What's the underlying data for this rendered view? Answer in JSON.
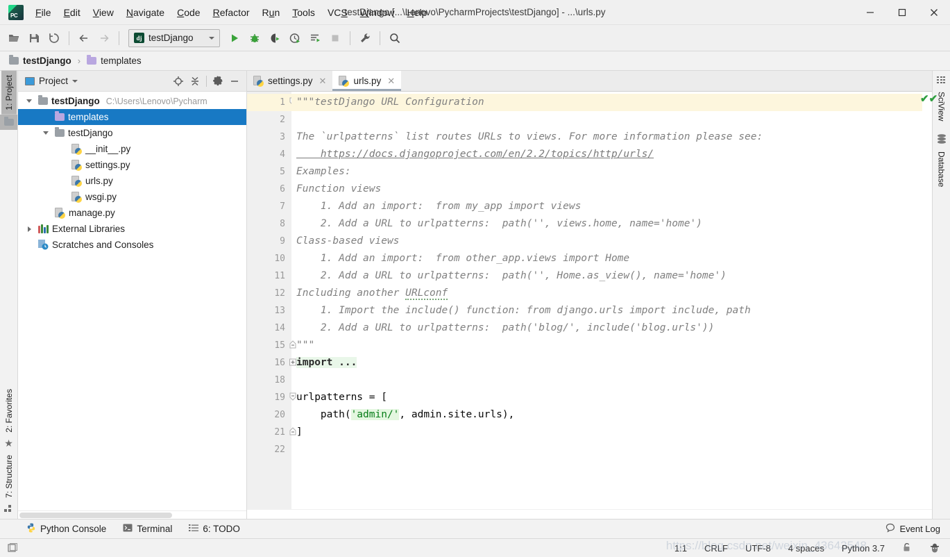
{
  "window": {
    "title": "testDjango [...\\Lenovo\\PycharmProjects\\testDjango] - ...\\urls.py",
    "logo_text": "PC",
    "minimize": "—",
    "maximize": "☐",
    "close": "✕"
  },
  "menubar": {
    "items": [
      {
        "label": "File",
        "mnemonic": "F"
      },
      {
        "label": "Edit",
        "mnemonic": "E"
      },
      {
        "label": "View",
        "mnemonic": "V"
      },
      {
        "label": "Navigate",
        "mnemonic": "N"
      },
      {
        "label": "Code",
        "mnemonic": "C"
      },
      {
        "label": "Refactor",
        "mnemonic": "R"
      },
      {
        "label": "Run",
        "mnemonic": "u"
      },
      {
        "label": "Tools",
        "mnemonic": "T"
      },
      {
        "label": "VCS",
        "mnemonic": "S"
      },
      {
        "label": "Window",
        "mnemonic": "W"
      },
      {
        "label": "Help",
        "mnemonic": "H"
      }
    ]
  },
  "toolbar": {
    "run_config": {
      "label": "testDjango",
      "icon_text": "dj"
    },
    "buttons": [
      "open-project-icon",
      "save-all-icon",
      "sync-icon",
      "navigate-back-icon",
      "navigate-forward-icon",
      "run-icon",
      "debug-icon",
      "run-coverage-icon",
      "profile-icon",
      "run-to-cursor-icon",
      "stop-icon",
      "settings-wrench-icon",
      "search-everywhere-icon"
    ]
  },
  "breadcrumb": {
    "items": [
      {
        "label": "testDjango",
        "icon": "folder-icon",
        "color": "#9aa0a6",
        "bold": true
      },
      {
        "label": "templates",
        "icon": "folder-icon",
        "color": "#b9a7e0",
        "bold": false
      }
    ],
    "separator": "›"
  },
  "left_strip": {
    "tabs": [
      {
        "label": "1: Project",
        "mnemonic": "1",
        "active": true,
        "icon": "project-folder-icon"
      },
      {
        "label": "2: Favorites",
        "mnemonic": "2",
        "active": false,
        "icon": "star-icon"
      },
      {
        "label": "7: Structure",
        "mnemonic": "7",
        "active": false,
        "icon": "structure-icon"
      }
    ]
  },
  "right_strip": {
    "tabs": [
      {
        "label": "SciView",
        "icon": "grid-icon"
      },
      {
        "label": "Database",
        "icon": "database-icon"
      }
    ]
  },
  "project_panel": {
    "title": "Project",
    "header_icons": [
      "locate-target-icon",
      "collapse-all-icon",
      "gear-icon",
      "minimize-icon"
    ],
    "tree": [
      {
        "label": "testDjango",
        "path": "C:\\Users\\Lenovo\\Pycharm",
        "depth": 0,
        "icon": "folder-icon",
        "expander": "down",
        "bold": true,
        "selected": false
      },
      {
        "label": "templates",
        "path": "",
        "depth": 1,
        "icon": "folder-purple-icon",
        "expander": "none",
        "bold": false,
        "selected": true
      },
      {
        "label": "testDjango",
        "path": "",
        "depth": 1,
        "icon": "package-folder-icon",
        "expander": "down",
        "bold": false,
        "selected": false
      },
      {
        "label": "__init__.py",
        "path": "",
        "depth": 2,
        "icon": "python-file-icon",
        "expander": "none",
        "bold": false,
        "selected": false
      },
      {
        "label": "settings.py",
        "path": "",
        "depth": 2,
        "icon": "python-file-icon",
        "expander": "none",
        "bold": false,
        "selected": false
      },
      {
        "label": "urls.py",
        "path": "",
        "depth": 2,
        "icon": "python-file-icon",
        "expander": "none",
        "bold": false,
        "selected": false
      },
      {
        "label": "wsgi.py",
        "path": "",
        "depth": 2,
        "icon": "python-file-icon",
        "expander": "none",
        "bold": false,
        "selected": false
      },
      {
        "label": "manage.py",
        "path": "",
        "depth": 1,
        "icon": "python-file-icon",
        "expander": "none",
        "bold": false,
        "selected": false
      },
      {
        "label": "External Libraries",
        "path": "",
        "depth": 0,
        "icon": "libraries-icon",
        "expander": "right",
        "bold": false,
        "selected": false
      },
      {
        "label": "Scratches and Consoles",
        "path": "",
        "depth": 0,
        "icon": "scratches-icon",
        "expander": "none",
        "bold": false,
        "selected": false
      }
    ]
  },
  "editor": {
    "tabs": [
      {
        "label": "settings.py",
        "icon": "python-file-icon",
        "active": false,
        "close": "✕"
      },
      {
        "label": "urls.py",
        "icon": "python-file-icon",
        "active": true,
        "close": "✕"
      }
    ],
    "inspection_status": "no-errors",
    "inspection_glyph": "✔✔",
    "lines": [
      {
        "num": "1",
        "indent": 0,
        "fold": "collapse",
        "current": true,
        "text": "\"\"\"testDjango URL Configuration",
        "style": "doc"
      },
      {
        "num": "2",
        "indent": 0,
        "fold": "",
        "current": false,
        "text": "",
        "style": "doc"
      },
      {
        "num": "3",
        "indent": 0,
        "fold": "",
        "current": false,
        "text": "The `urlpatterns` list routes URLs to views. For more information please see:",
        "style": "doc"
      },
      {
        "num": "4",
        "indent": 4,
        "fold": "",
        "current": false,
        "text": "https://docs.djangoproject.com/en/2.2/topics/http/urls/",
        "style": "link"
      },
      {
        "num": "5",
        "indent": 0,
        "fold": "",
        "current": false,
        "text": "Examples:",
        "style": "doc"
      },
      {
        "num": "6",
        "indent": 0,
        "fold": "",
        "current": false,
        "text": "Function views",
        "style": "doc"
      },
      {
        "num": "7",
        "indent": 4,
        "fold": "",
        "current": false,
        "text": "1. Add an import:  from my_app import views",
        "style": "doc"
      },
      {
        "num": "8",
        "indent": 4,
        "fold": "",
        "current": false,
        "text": "2. Add a URL to urlpatterns:  path('', views.home, name='home')",
        "style": "doc"
      },
      {
        "num": "9",
        "indent": 0,
        "fold": "",
        "current": false,
        "text": "Class-based views",
        "style": "doc"
      },
      {
        "num": "10",
        "indent": 4,
        "fold": "",
        "current": false,
        "text": "1. Add an import:  from other_app.views import Home",
        "style": "doc"
      },
      {
        "num": "11",
        "indent": 4,
        "fold": "",
        "current": false,
        "text": "2. Add a URL to urlpatterns:  path('', Home.as_view(), name='home')",
        "style": "doc"
      },
      {
        "num": "12",
        "indent": 0,
        "fold": "",
        "current": false,
        "text": "Including another URLconf",
        "style": "doc-squiggle",
        "squiggle_word": "URLconf"
      },
      {
        "num": "13",
        "indent": 4,
        "fold": "",
        "current": false,
        "text": "1. Import the include() function: from django.urls import include, path",
        "style": "doc"
      },
      {
        "num": "14",
        "indent": 4,
        "fold": "",
        "current": false,
        "text": "2. Add a URL to urlpatterns:  path('blog/', include('blog.urls'))",
        "style": "doc"
      },
      {
        "num": "15",
        "indent": 0,
        "fold": "foldend",
        "current": false,
        "text": "\"\"\"",
        "style": "doc"
      },
      {
        "num": "16",
        "indent": 0,
        "fold": "expand",
        "current": false,
        "text": "import ...",
        "style": "folded"
      },
      {
        "num": "18",
        "indent": 0,
        "fold": "",
        "current": false,
        "text": "",
        "style": "code"
      },
      {
        "num": "19",
        "indent": 0,
        "fold": "collapse",
        "current": false,
        "text": "urlpatterns = [",
        "style": "code"
      },
      {
        "num": "20",
        "indent": 4,
        "fold": "",
        "current": false,
        "text": "path('admin/', admin.site.urls),",
        "style": "code-path",
        "string_literal": "'admin/'"
      },
      {
        "num": "21",
        "indent": 0,
        "fold": "foldend",
        "current": false,
        "text": "]",
        "style": "code"
      },
      {
        "num": "22",
        "indent": 0,
        "fold": "",
        "current": false,
        "text": "",
        "style": "code"
      }
    ]
  },
  "bottom_bar": {
    "items": [
      {
        "label": "Python Console",
        "icon": "python-icon",
        "mnemonic": ""
      },
      {
        "label": "Terminal",
        "icon": "terminal-icon",
        "mnemonic": ""
      },
      {
        "label": "6: TODO",
        "icon": "todo-list-icon",
        "mnemonic": "6"
      }
    ],
    "event_log": {
      "label": "Event Log",
      "icon": "balloon-icon"
    }
  },
  "status_bar": {
    "caret_position": "1:1",
    "line_separator": "CRLF",
    "encoding": "UTF-8",
    "indent": "4 spaces",
    "interpreter": "Python 3.7",
    "lock_icon": "lock-icon",
    "hector_icon": "hector-inspection-icon",
    "watermark": "https://blog.csdn.net/weixin_43643548"
  },
  "colors": {
    "accent_selection": "#1879c4",
    "current_line": "#fdf6dd",
    "run_green": "#43a047",
    "string_green": "#067d17",
    "keyword_blue": "#000080",
    "doc_gray": "#808080",
    "folded_bg": "#e9f7e9"
  }
}
